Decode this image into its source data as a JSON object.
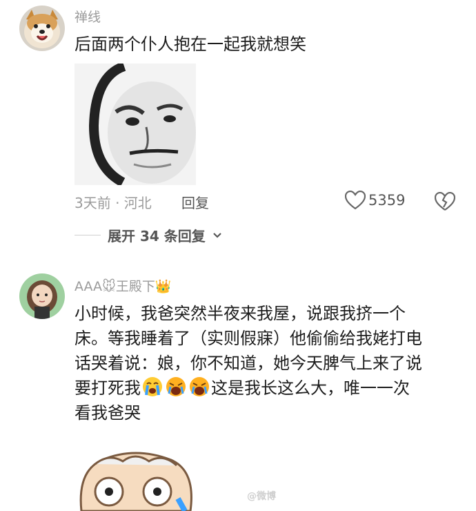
{
  "comments": [
    {
      "username": "禅线",
      "text": "后面两个仆人抱在一起我就想笑",
      "meta": "3天前 · 河北",
      "reply_label": "回复",
      "likes": "5359",
      "expand_label": "展开 34 条回复",
      "avatar_icon": "shiba-dog-avatar",
      "image_icon": "panda-meme-face"
    },
    {
      "username": "AAA🐭王殿下👑",
      "text_lines": [
        "小时候，我爸突然半夜来我屋，说跟我挤一个",
        "床。等我睡着了（实则假寐）他偷偷给我姥打电",
        "话哭着说：娘，你不知道，她今天脾气上来了说"
      ],
      "text_line4_before": "要打死我",
      "text_line4_after": "这是我长这么大，唯一一次",
      "text_line5": "看我爸哭",
      "emojis": [
        "crying-face-emoji",
        "crying-face-emoji",
        "crying-face-emoji"
      ],
      "avatar_icon": "cartoon-girl-avatar",
      "image_icon": "cartoon-sheep-face"
    }
  ],
  "watermark": "@微博"
}
